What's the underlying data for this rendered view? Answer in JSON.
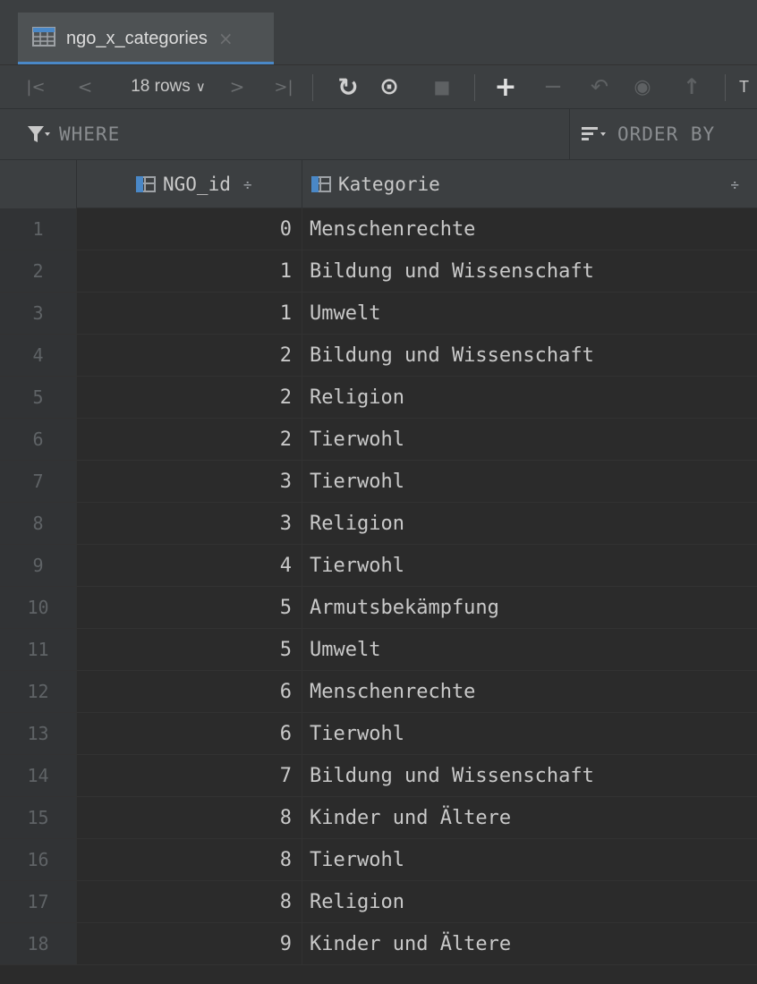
{
  "tab": {
    "title": "ngo_x_categories",
    "close_glyph": "×",
    "icon": "table-icon"
  },
  "toolbar": {
    "first": "|<",
    "prev": "<",
    "rows_label": "18 rows",
    "rows_chevron": "∨",
    "next": ">",
    "last": ">|",
    "refresh": "↻",
    "history": "⊙",
    "stop": "■",
    "add": "+",
    "remove": "−",
    "revert": "↶",
    "preview": "◉",
    "submit": "↑",
    "overflow": "T"
  },
  "filter": {
    "where": "WHERE",
    "order_by": "ORDER BY",
    "icon": "filter-funnel-icon"
  },
  "columns": [
    {
      "name": "NGO_id",
      "icon": "column-table-icon",
      "sort": "÷"
    },
    {
      "name": "Kategorie",
      "icon": "column-table-icon",
      "sort": "÷"
    }
  ],
  "rows": [
    {
      "n": "1",
      "id": "0",
      "kat": "Menschenrechte"
    },
    {
      "n": "2",
      "id": "1",
      "kat": "Bildung und Wissenschaft"
    },
    {
      "n": "3",
      "id": "1",
      "kat": "Umwelt"
    },
    {
      "n": "4",
      "id": "2",
      "kat": "Bildung und Wissenschaft"
    },
    {
      "n": "5",
      "id": "2",
      "kat": "Religion"
    },
    {
      "n": "6",
      "id": "2",
      "kat": "Tierwohl"
    },
    {
      "n": "7",
      "id": "3",
      "kat": "Tierwohl"
    },
    {
      "n": "8",
      "id": "3",
      "kat": "Religion"
    },
    {
      "n": "9",
      "id": "4",
      "kat": "Tierwohl"
    },
    {
      "n": "10",
      "id": "5",
      "kat": "Armutsbekämpfung"
    },
    {
      "n": "11",
      "id": "5",
      "kat": "Umwelt"
    },
    {
      "n": "12",
      "id": "6",
      "kat": "Menschenrechte"
    },
    {
      "n": "13",
      "id": "6",
      "kat": "Tierwohl"
    },
    {
      "n": "14",
      "id": "7",
      "kat": "Bildung und Wissenschaft"
    },
    {
      "n": "15",
      "id": "8",
      "kat": "Kinder und Ältere"
    },
    {
      "n": "16",
      "id": "8",
      "kat": "Tierwohl"
    },
    {
      "n": "17",
      "id": "8",
      "kat": "Religion"
    },
    {
      "n": "18",
      "id": "9",
      "kat": "Kinder und Ältere"
    }
  ],
  "colors": {
    "accent": "#4a88c7",
    "background": "#2b2b2b",
    "panel": "#3c3f41"
  }
}
